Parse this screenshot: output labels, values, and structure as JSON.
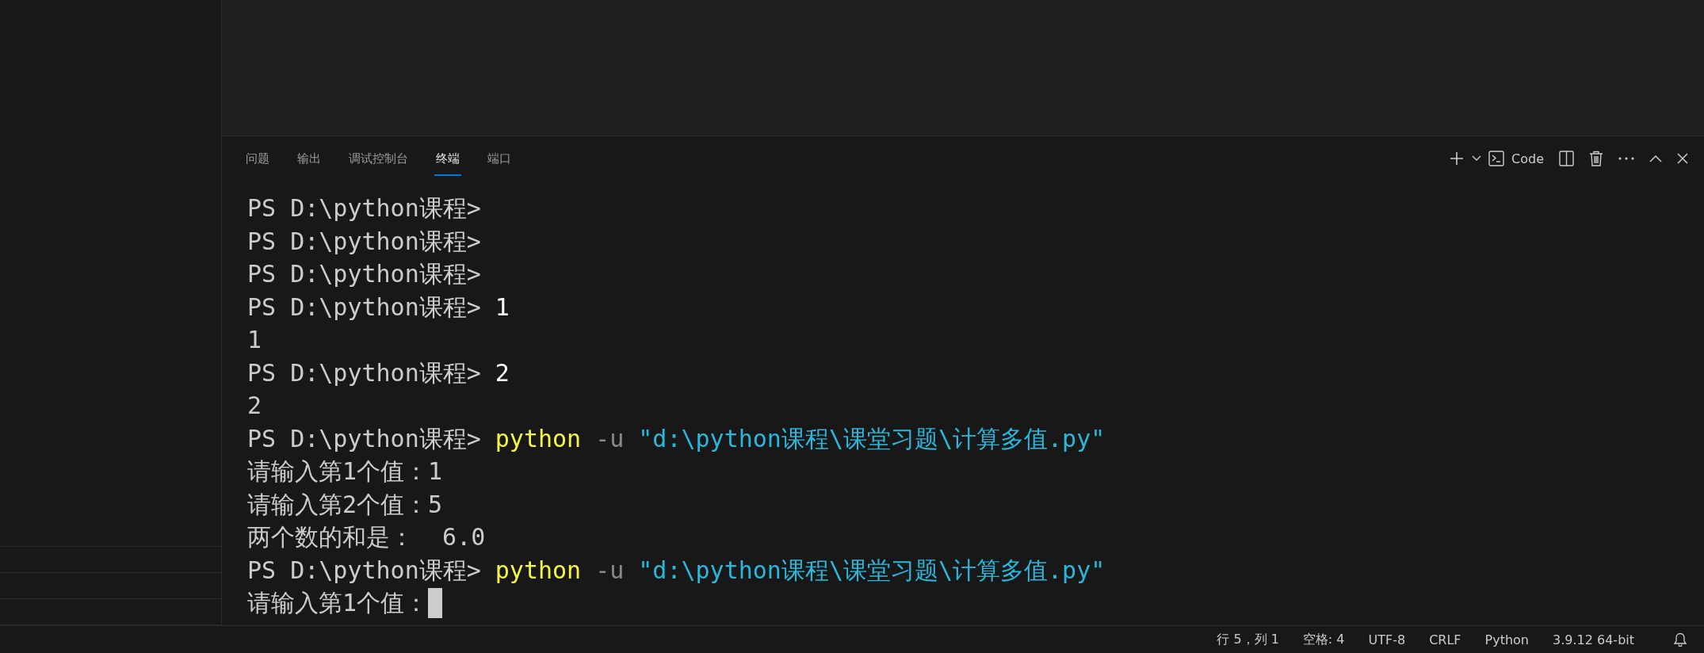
{
  "panel": {
    "tabs": [
      {
        "label": "问题",
        "selected": false
      },
      {
        "label": "输出",
        "selected": false
      },
      {
        "label": "调试控制台",
        "selected": false
      },
      {
        "label": "终端",
        "selected": true
      },
      {
        "label": "端口",
        "selected": false
      }
    ],
    "terminal_name": "Code"
  },
  "terminal": {
    "lines": [
      {
        "cursor": false,
        "segments": [
          {
            "kind": "prompt",
            "text": "PS D:\\python课程>"
          }
        ]
      },
      {
        "cursor": false,
        "segments": [
          {
            "kind": "prompt",
            "text": "PS D:\\python课程>"
          }
        ]
      },
      {
        "cursor": false,
        "segments": [
          {
            "kind": "prompt",
            "text": "PS D:\\python课程>"
          }
        ]
      },
      {
        "cursor": false,
        "segments": [
          {
            "kind": "prompt",
            "text": "PS D:\\python课程>"
          },
          {
            "kind": "input",
            "text": "1"
          }
        ]
      },
      {
        "cursor": false,
        "segments": [
          {
            "kind": "output",
            "text": "1"
          }
        ]
      },
      {
        "cursor": false,
        "segments": [
          {
            "kind": "prompt",
            "text": "PS D:\\python课程>"
          },
          {
            "kind": "input",
            "text": "2"
          }
        ]
      },
      {
        "cursor": false,
        "segments": [
          {
            "kind": "output",
            "text": "2"
          }
        ]
      },
      {
        "cursor": false,
        "segments": [
          {
            "kind": "prompt",
            "text": "PS D:\\python课程>"
          },
          {
            "kind": "command",
            "text": "python"
          },
          {
            "kind": "flag",
            "text": "-u"
          },
          {
            "kind": "string",
            "text": "\"d:\\python课程\\课堂习题\\计算多值.py\""
          }
        ]
      },
      {
        "cursor": false,
        "segments": [
          {
            "kind": "output",
            "text": "请输入第1个值：1"
          }
        ]
      },
      {
        "cursor": false,
        "segments": [
          {
            "kind": "output",
            "text": "请输入第2个值：5"
          }
        ]
      },
      {
        "cursor": false,
        "segments": [
          {
            "kind": "output",
            "text": "两个数的和是：  6.0"
          }
        ]
      },
      {
        "cursor": false,
        "segments": [
          {
            "kind": "prompt",
            "text": "PS D:\\python课程>"
          },
          {
            "kind": "command",
            "text": "python"
          },
          {
            "kind": "flag",
            "text": "-u"
          },
          {
            "kind": "string",
            "text": "\"d:\\python课程\\课堂习题\\计算多值.py\""
          }
        ]
      },
      {
        "cursor": true,
        "segments": [
          {
            "kind": "output",
            "text": "请输入第1个值："
          }
        ]
      }
    ]
  },
  "status_bar": {
    "items": [
      "行 5，列 1",
      "空格: 4",
      "UTF-8",
      "CRLF",
      "Python",
      "3.9.12 64-bit"
    ]
  }
}
